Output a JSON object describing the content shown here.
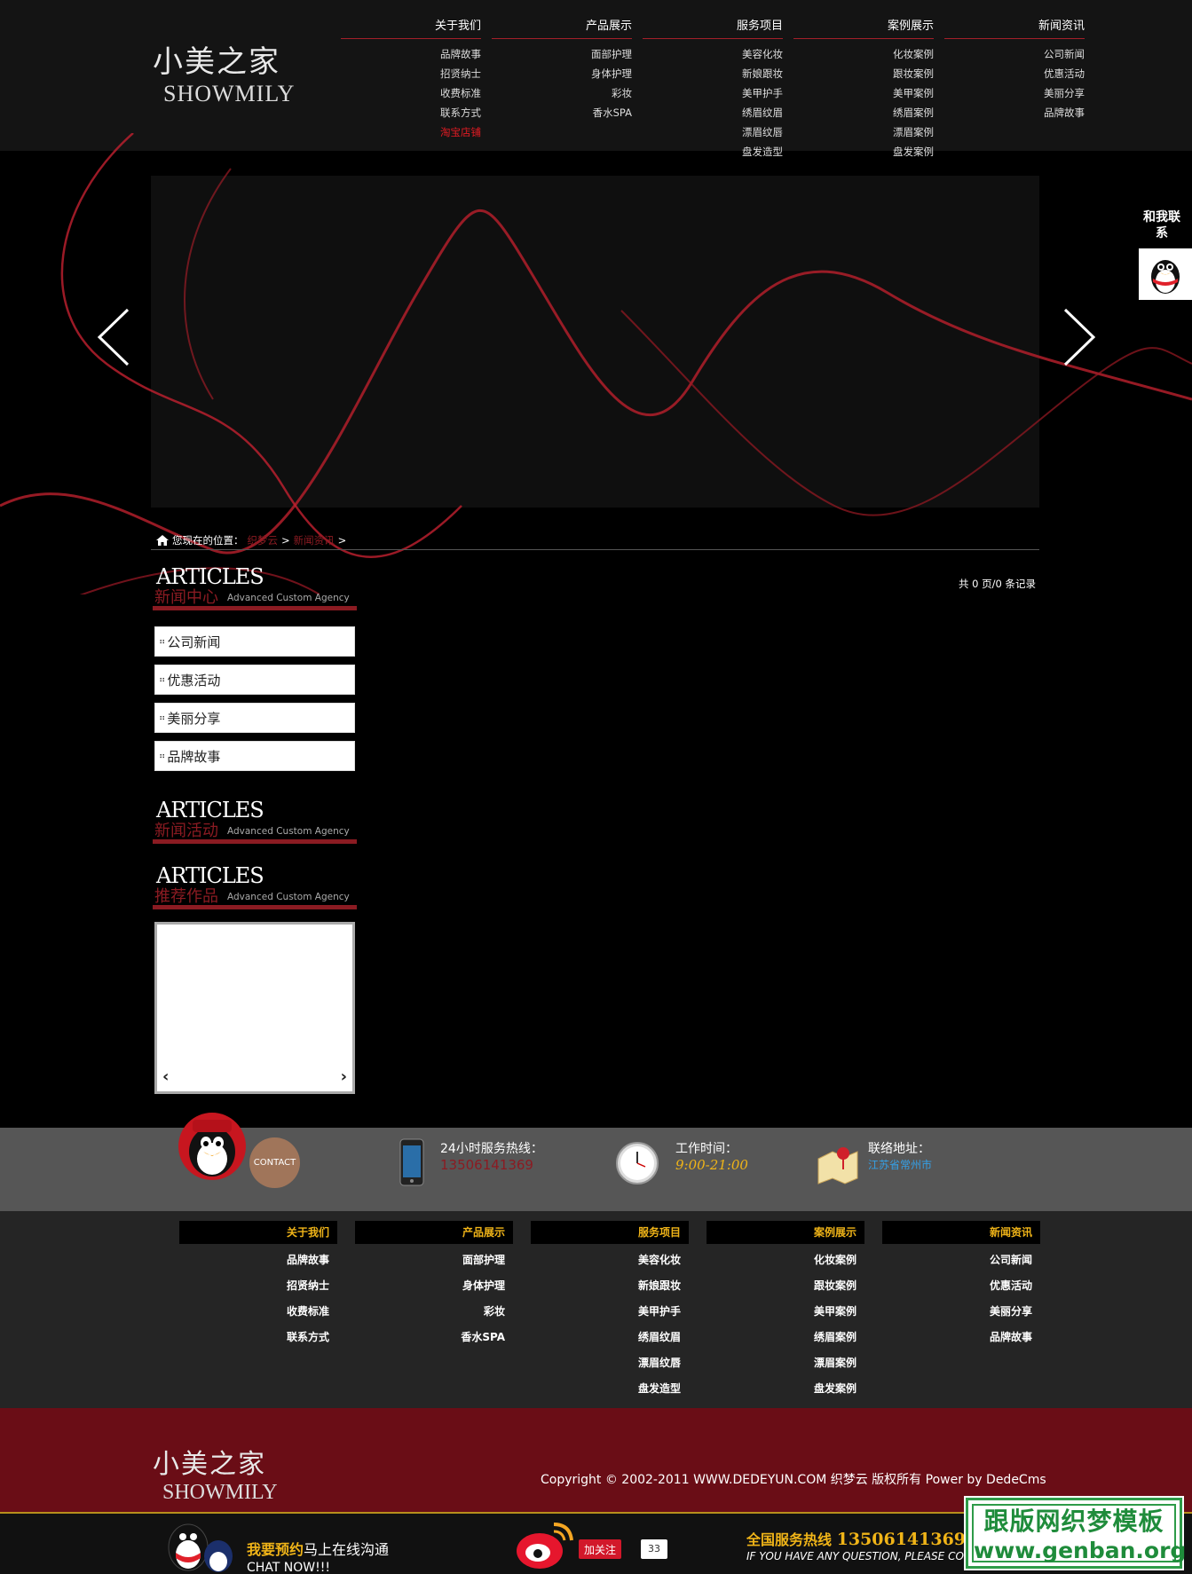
{
  "brand": {
    "name_cn": "小美之家",
    "name_en": "SHOWMILY"
  },
  "nav": [
    {
      "label": "关于我们",
      "items": [
        "品牌故事",
        "招贤纳士",
        "收费标准",
        "联系方式",
        "淘宝店铺"
      ]
    },
    {
      "label": "产品展示",
      "items": [
        "面部护理",
        "身体护理",
        "彩妆",
        "香水SPA"
      ]
    },
    {
      "label": "服务项目",
      "items": [
        "美容化妆",
        "新娘跟妆",
        "美甲护手",
        "绣眉纹眉",
        "漂眉纹唇",
        "盘发造型"
      ]
    },
    {
      "label": "案例展示",
      "items": [
        "化妆案例",
        "跟妆案例",
        "美甲案例",
        "绣眉案例",
        "漂眉案例",
        "盘发案例"
      ]
    },
    {
      "label": "新闻资讯",
      "items": [
        "公司新闻",
        "优惠活动",
        "美丽分享",
        "品牌故事"
      ]
    }
  ],
  "float_contact": {
    "label": "和我联系"
  },
  "breadcrumb": {
    "prefix": "您现在的位置：",
    "items": [
      "织梦云",
      "新闻资讯"
    ],
    "sep": ">"
  },
  "sidebar": {
    "news_center": {
      "big": "ARTICLES",
      "cn": "新闻中心",
      "en": "Advanced Custom Agency"
    },
    "categories": [
      "公司新闻",
      "优惠活动",
      "美丽分享",
      "品牌故事"
    ],
    "news_events": {
      "big": "ARTICLES",
      "cn": "新闻活动",
      "en": "Advanced Custom Agency"
    },
    "recommended": {
      "big": "ARTICLES",
      "cn": "推荐作品",
      "en": "Advanced Custom Agency"
    }
  },
  "pager": "共 0 页/0 条记录",
  "info": {
    "contact_badge": "CONTACT",
    "hotline_label": "24小时服务热线：",
    "hotline_value": "13506141369",
    "hours_label": "工作时间：",
    "hours_value": "9:00-21:00",
    "address_label": "联络地址：",
    "address_value": "江苏省常州市"
  },
  "copyright": "Copyright © 2002-2011 WWW.DEDEYUN.COM 织梦云 版权所有 Power by DedeCms",
  "bottom": {
    "chat_strong": "我要预约",
    "chat_rest": "马上在线沟通",
    "chat_en": "CHAT NOW!!!",
    "follow": "加关注",
    "follow_count": "33",
    "hotline_label": "全国服务热线",
    "hotline_number": "13506141369",
    "question": "IF YOU HAVE ANY QUESTION, PLEASE CO"
  },
  "watermark": {
    "line1": "跟版网织梦模板",
    "line2": "www.genban.org"
  },
  "colors": {
    "accent_red": "#8b1b22",
    "gold": "#f0b418",
    "footer_band": "#6a0d16"
  }
}
